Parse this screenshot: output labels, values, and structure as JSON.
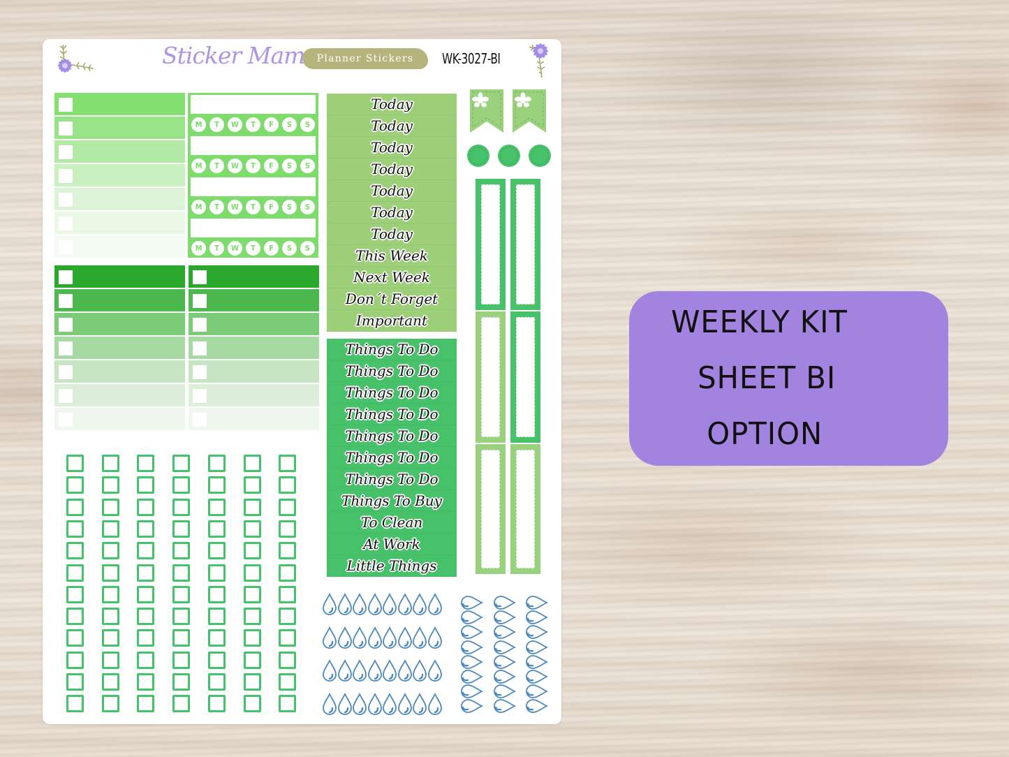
{
  "header": {
    "brand_name": "Sticker Mama",
    "brand_tagline": "Planner Stickers",
    "sku": "WK-3027-BI"
  },
  "colors": {
    "brand_purple": "#ae94e6",
    "badge_purple": "#a383e0",
    "tag_olive": "#b6b37c",
    "bright_green": "#7ddc6b",
    "mid_green": "#47c26a",
    "sage_green": "#9ad17c",
    "deep_green": "#2aa82c",
    "water_blue": "#4a88bf"
  },
  "checklist_light": {
    "rows": 7,
    "shades": [
      "#84e06f",
      "#98e387",
      "#b2eaa5",
      "#c9f0bf",
      "#dcf4d5",
      "#ebf8e6",
      "#f4fbf2"
    ]
  },
  "checklist_dark_left": {
    "rows": 7,
    "shades": [
      "#2aa82c",
      "#4cb84d",
      "#7ccb79",
      "#a7daa3",
      "#c6e6c3",
      "#ddefdb",
      "#f0f7ef"
    ]
  },
  "checklist_dark_right": {
    "rows": 7,
    "shades": [
      "#2aa82c",
      "#4cb84d",
      "#7ccb79",
      "#a7daa3",
      "#c6e6c3",
      "#ddefdb",
      "#f0f7ef"
    ]
  },
  "habit_tracker": {
    "rows": 4,
    "days": [
      "M",
      "T",
      "W",
      "T",
      "F",
      "S",
      "S"
    ]
  },
  "word_stickers_top": {
    "background": "#9ccf78",
    "items": [
      "Today",
      "Today",
      "Today",
      "Today",
      "Today",
      "Today",
      "Today",
      "This Week",
      "Next Week",
      "Don´t Forget",
      "Important"
    ]
  },
  "word_stickers_bottom": {
    "background": "#47c26a",
    "items": [
      "Things To Do",
      "Things To Do",
      "Things To Do",
      "Things To Do",
      "Things To Do",
      "Things To Do",
      "Things To Do",
      "Things To Buy",
      "To Clean",
      "At Work",
      "Little Things"
    ]
  },
  "flags": [
    {
      "icon": "flower-icon"
    },
    {
      "icon": "flower-icon"
    }
  ],
  "dots": 3,
  "frames": {
    "columns": [
      [
        "mid",
        "light",
        "light"
      ],
      [
        "mid",
        "mid",
        "light"
      ]
    ]
  },
  "checkbox_grid": {
    "columns": 7,
    "rows": 12
  },
  "water_drops_upright": {
    "rows": 4,
    "per_row": 8
  },
  "water_drops_sideways": {
    "columns": 3,
    "per_column": 8
  },
  "badge": {
    "lines": [
      "WEEKLY KIT",
      "SHEET BI",
      "OPTION"
    ]
  }
}
